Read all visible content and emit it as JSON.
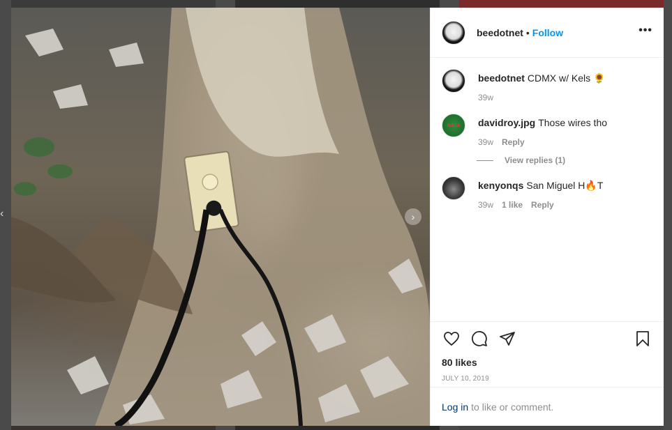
{
  "post": {
    "username": "beedotnet",
    "separator": "•",
    "follow_label": "Follow",
    "more_label": "•••",
    "next_arrow": "›"
  },
  "comments": [
    {
      "user": "beedotnet",
      "text": "CDMX w/ Kels 🌻",
      "time": "39w",
      "likes": "",
      "reply": ""
    },
    {
      "user": "davidroy.jpg",
      "text": "Those wires tho",
      "time": "39w",
      "likes": "",
      "reply": "Reply",
      "avatar_text": "NASA"
    },
    {
      "user": "kenyonqs",
      "text": "San Miguel H🔥T",
      "time": "39w",
      "likes": "1 like",
      "reply": "Reply"
    }
  ],
  "view_replies": "View replies (1)",
  "actions": {
    "icons": [
      "heart-icon",
      "comment-icon",
      "share-icon",
      "bookmark-icon"
    ],
    "likes": "80 likes",
    "date": "JULY 10, 2019"
  },
  "login": {
    "link": "Log in",
    "text": "to like or comment."
  },
  "colors": {
    "accent": "#0095f6",
    "text": "#262626",
    "muted": "#8e8e8e"
  }
}
